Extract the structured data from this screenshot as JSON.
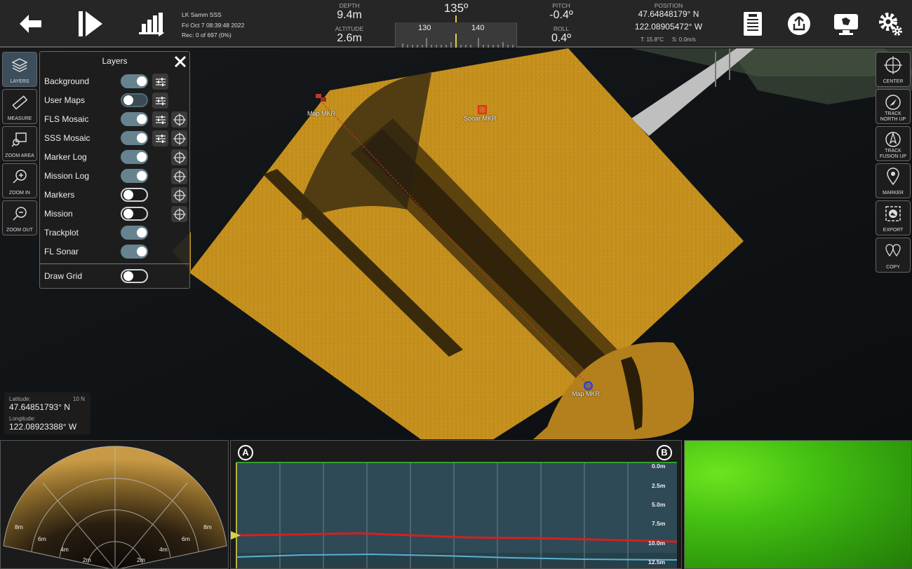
{
  "toolbar": {
    "back_icon": "back-arrow-icon",
    "play_icon": "play-step-icon",
    "stats_icon": "bar-chart-icon"
  },
  "session": {
    "name": "LK Samm SSS",
    "datetime": "Fri Oct 7 08:39:48 2022",
    "record": "Rec: 0 of 697 (0%)"
  },
  "telemetry": {
    "depth_label": "DEPTH",
    "depth_value": "9.4m",
    "altitude_label": "ALTITUDE",
    "altitude_value": "2.6m",
    "heading_value": "135º",
    "compass_ticks": [
      "130",
      "140"
    ],
    "pitch_label": "PITCH",
    "pitch_value": "-0.4º",
    "roll_label": "ROLL",
    "roll_value": "0.4º",
    "position_label": "POSITION",
    "latitude": "47.64848179° N",
    "longitude": "122.08905472° W",
    "temperature": "T: 15.8°C",
    "speed": "S: 0.0m/s"
  },
  "left_tools": [
    {
      "label": "LAYERS",
      "icon": "layers-icon"
    },
    {
      "label": "MEASURE",
      "icon": "ruler-icon"
    },
    {
      "label": "ZOOM AREA",
      "icon": "zoom-area-icon"
    },
    {
      "label": "ZOOM IN",
      "icon": "zoom-in-icon"
    },
    {
      "label": "ZOOM OUT",
      "icon": "zoom-out-icon"
    }
  ],
  "right_tools": [
    {
      "label": "CENTER",
      "icon": "crosshair-icon"
    },
    {
      "label": "TRACK NORTH UP",
      "icon": "compass-north-icon"
    },
    {
      "label": "TRACK FUSION UP",
      "icon": "compass-fusion-icon"
    },
    {
      "label": "MARKER",
      "icon": "map-pin-icon"
    },
    {
      "label": "EXPORT",
      "icon": "export-image-icon"
    },
    {
      "label": "COPY",
      "icon": "copy-pins-icon"
    }
  ],
  "layers_panel": {
    "title": "Layers",
    "rows": [
      {
        "name": "Background",
        "state": "on",
        "settings": true,
        "locate": false
      },
      {
        "name": "User Maps",
        "state": "off",
        "settings": true,
        "locate": false
      },
      {
        "name": "FLS Mosaic",
        "state": "on",
        "settings": true,
        "locate": true
      },
      {
        "name": "SSS Mosaic",
        "state": "on",
        "settings": true,
        "locate": true
      },
      {
        "name": "Marker Log",
        "state": "on",
        "settings": false,
        "locate": true
      },
      {
        "name": "Mission Log",
        "state": "on",
        "settings": false,
        "locate": true
      },
      {
        "name": "Markers",
        "state": "off",
        "settings": false,
        "locate": true
      },
      {
        "name": "Mission",
        "state": "off",
        "settings": false,
        "locate": true
      },
      {
        "name": "Trackplot",
        "state": "on",
        "settings": false,
        "locate": false
      },
      {
        "name": "FL Sonar",
        "state": "on",
        "settings": false,
        "locate": false
      }
    ],
    "draw_grid": {
      "name": "Draw Grid",
      "state": "off"
    }
  },
  "map_markers": {
    "map_mkr_1": "Map MKR",
    "sonar_mkr": "Sonar MKR",
    "map_mkr_2": "Map MKR"
  },
  "cursor": {
    "latitude_label": "Latitude:",
    "zone": "10 N",
    "latitude": "47.64851793° N",
    "longitude_label": "Longitude:",
    "longitude": "122.08923388° W"
  },
  "fls": {
    "range_labels": [
      "8m",
      "6m",
      "4m",
      "2m",
      "2m",
      "4m",
      "6m",
      "8m"
    ]
  },
  "profile": {
    "point_a": "A",
    "point_b": "B",
    "depth_ticks": [
      "0.0m",
      "2.5m",
      "5.0m",
      "7.5m",
      "10.0m",
      "12.5m"
    ]
  },
  "colors": {
    "sonar": "#c8961f",
    "accent_toggle": "#66838f",
    "profile_red": "#d42020",
    "profile_blue": "#5ab2d2",
    "camera_green": "#4fd612"
  }
}
